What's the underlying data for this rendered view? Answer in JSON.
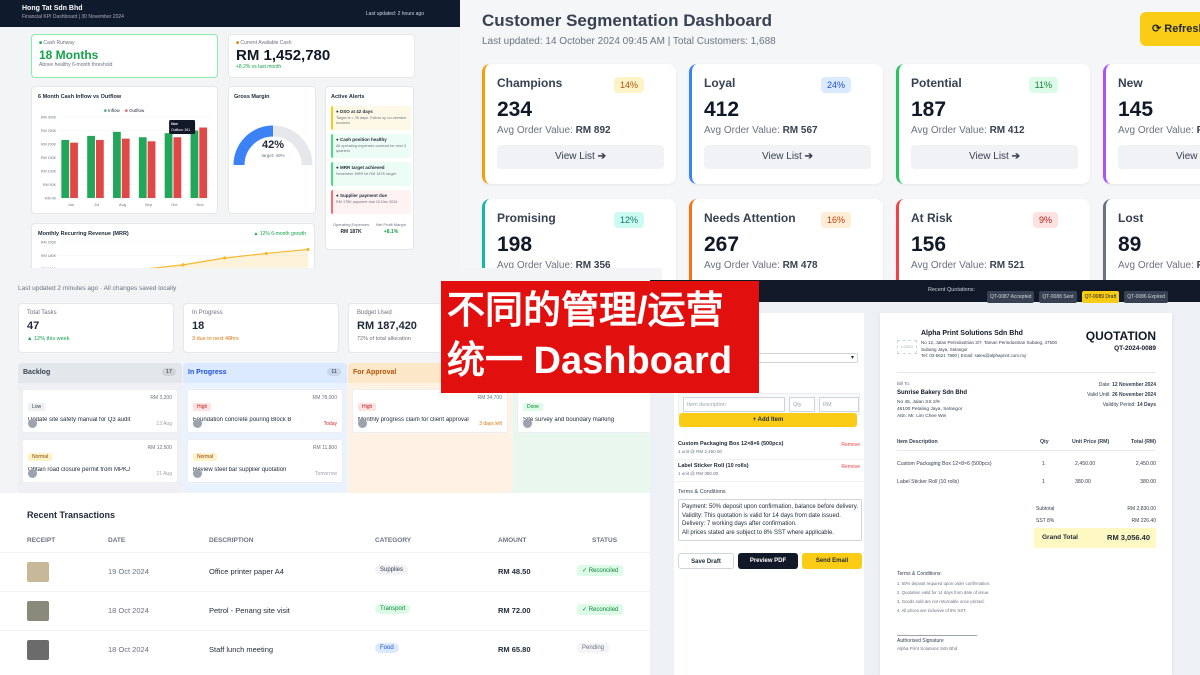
{
  "kpi": {
    "company": "Hong Tat Sdn Bhd",
    "subtitle": "Financial KPI Dashboard | 30 November 2024",
    "updated": "Last updated: 2 hours ago",
    "runway_label": "Cash Runway",
    "runway_value": "18 Months",
    "runway_note": "Above healthy 6-month threshold",
    "cash_label": "Current Available Cash",
    "cash_value": "RM 1,452,780",
    "cash_note": "+8.2% vs last month",
    "chart_title": "6 Month Cash Inflow vs Outflow",
    "legend_in": "Inflow",
    "legend_out": "Outflow",
    "tooltip_title": "Nov",
    "tooltip_value": "Outflow: 261",
    "margin_title": "Gross Margin",
    "margin_value": "42%",
    "margin_target": "target: 40%",
    "alerts_title": "Active Alerts",
    "alerts": [
      {
        "t": "DSO at 42 days",
        "d": "Target is < 35 days. Follow up on overdue invoices",
        "bg": "#fef9e7",
        "bd": "#facc15"
      },
      {
        "t": "Cash position healthy",
        "d": "All operating expenses covered for next 3 quarters",
        "bg": "#ecfdf5",
        "bd": "#4ade80"
      },
      {
        "t": "MRR target achieved",
        "d": "November MRR hit RM 187K target",
        "bg": "#ecfdf5",
        "bd": "#4ade80"
      },
      {
        "t": "Supplier payment due",
        "d": "RM 175K payment due 10 Dec 2024",
        "bg": "#fef2f2",
        "bd": "#f87171"
      }
    ],
    "mrr_title": "Monthly Recurring Revenue (MRR)",
    "mrr_growth": "▲ 12% 6-month growth",
    "opex_label": "Operating Expenses",
    "opex_value": "RM 187K",
    "net_label": "Net Profit Margin",
    "net_value": "+8.1%"
  },
  "chart_data": {
    "type": "bar",
    "title": "6 Month Cash Inflow vs Outflow",
    "categories": [
      "Jun",
      "Jul",
      "Aug",
      "Sep",
      "Oct",
      "Nov"
    ],
    "ylim": [
      0,
      300
    ],
    "y_ticks": [
      "RM 300K",
      "RM 250K",
      "RM 200K",
      "RM 150K",
      "RM 100K",
      "RM 50K",
      "RM 0K"
    ],
    "series": [
      {
        "name": "Inflow",
        "values": [
          215,
          230,
          245,
          225,
          240,
          250
        ],
        "color": "#22a65a"
      },
      {
        "name": "Outflow",
        "values": [
          205,
          215,
          220,
          210,
          225,
          261
        ],
        "color": "#e04848"
      }
    ]
  },
  "mrr_chart": {
    "type": "line",
    "y_ticks": [
      "RM 200K",
      "RM 180K",
      "RM 160K",
      "RM 140K"
    ],
    "values": [
      135,
      140,
      152,
      160,
      172,
      180,
      187
    ],
    "ylim": [
      130,
      200
    ]
  },
  "seg": {
    "title": "Customer Segmentation Dashboard",
    "subtitle": "Last updated: 14 October 2024 09:45 AM | Total Customers: 1,688",
    "refresh": "Refresh",
    "aov_label": "Avg Order Value:",
    "view": "View List",
    "cards": [
      {
        "name": "Champions",
        "pct": "14%",
        "count": "234",
        "aov": "RM 892",
        "color": "#f59e0b",
        "pbg": "#fef3c7",
        "pfg": "#b45309"
      },
      {
        "name": "Loyal",
        "pct": "24%",
        "count": "412",
        "aov": "RM 567",
        "color": "#3b82f6",
        "pbg": "#dbeafe",
        "pfg": "#1d4ed8"
      },
      {
        "name": "Potential",
        "pct": "11%",
        "count": "187",
        "aov": "RM 412",
        "color": "#22c55e",
        "pbg": "#dcfce7",
        "pfg": "#15803d"
      },
      {
        "name": "New",
        "pct": "",
        "count": "145",
        "aov": "RM 2",
        "color": "#a855f7",
        "pbg": "#f3e8ff",
        "pfg": "#7e22ce"
      },
      {
        "name": "Promising",
        "pct": "12%",
        "count": "198",
        "aov": "RM 356",
        "color": "#14b8a6",
        "pbg": "#ccfbf1",
        "pfg": "#0f766e"
      },
      {
        "name": "Needs Attention",
        "pct": "16%",
        "count": "267",
        "aov": "RM 478",
        "color": "#f97316",
        "pbg": "#ffedd5",
        "pfg": "#c2410c"
      },
      {
        "name": "At Risk",
        "pct": "9%",
        "count": "156",
        "aov": "RM 521",
        "color": "#ef4444",
        "pbg": "#fee2e2",
        "pfg": "#b91c1c"
      },
      {
        "name": "Lost",
        "pct": "",
        "count": "89",
        "aov": "RM 1",
        "color": "#6b7280",
        "pbg": "#f3f4f6",
        "pfg": "#374151"
      }
    ]
  },
  "tasks": {
    "updated": "Last updated 2 minutes ago · All changes saved locally",
    "stats": [
      {
        "label": "Total Tasks",
        "value": "47",
        "note": "▲ 12% this week",
        "nc": "#16a34a"
      },
      {
        "label": "In Progress",
        "value": "18",
        "note": "3 due in next 48hrs",
        "nc": "#d97706"
      },
      {
        "label": "Budget Used",
        "value": "RM 187,420",
        "note": "72% of total allocation",
        "nc": "#6b7280"
      }
    ],
    "columns": [
      {
        "name": "Backlog",
        "count": "17",
        "bg": "#eef0f3",
        "hd": "#e3e6ea",
        "fg": "#374151",
        "tasks": [
          {
            "tag": "Low",
            "amt": "RM 3,200",
            "title": "Update site safety manual for Q3 audit",
            "due": "13 Aug",
            "tbg": "#eef0f3",
            "tfg": "#374151",
            "dc": "#9ca3af"
          },
          {
            "tag": "Normal",
            "amt": "RM 12,500",
            "title": "Obtain road closure permit from MPKJ",
            "due": "21 Aug",
            "tbg": "#fef3c7",
            "tfg": "#92400e",
            "dc": "#9ca3af"
          }
        ]
      },
      {
        "name": "In Progress",
        "count": "11",
        "bg": "#eaf2fe",
        "hd": "#dbeafe",
        "fg": "#1d4ed8",
        "tasks": [
          {
            "tag": "High",
            "amt": "RM 78,000",
            "title": "Foundation concrete pouring Block B",
            "due": "Today",
            "tbg": "#fee2e2",
            "tfg": "#b91c1c",
            "dc": "#dc2626"
          },
          {
            "tag": "Normal",
            "amt": "RM 11,800",
            "title": "Review steel bar supplier quotation",
            "due": "Tomorrow",
            "tbg": "#fef3c7",
            "tfg": "#92400e",
            "dc": "#9ca3af"
          }
        ]
      },
      {
        "name": "For Approval",
        "count": "",
        "bg": "#fdf2e4",
        "hd": "#fde7c9",
        "fg": "#b45309",
        "tasks": [
          {
            "tag": "High",
            "amt": "RM 34,700",
            "title": "Monthly progress claim for client approval",
            "due": "3 days left",
            "tbg": "#fee2e2",
            "tfg": "#b91c1c",
            "dc": "#d97706"
          }
        ]
      },
      {
        "name": "",
        "count": "",
        "bg": "#eaf7ee",
        "hd": "#eaf7ee",
        "fg": "#15803d",
        "tasks": [
          {
            "tag": "Done",
            "amt": "",
            "title": "Site survey and boundary marking",
            "due": "✓ 2",
            "tbg": "#dcfce7",
            "tfg": "#15803d",
            "dc": "#16a34a"
          }
        ]
      }
    ]
  },
  "txn": {
    "title": "Recent Transactions",
    "headers": [
      "RECEIPT",
      "DATE",
      "DESCRIPTION",
      "CATEGORY",
      "AMOUNT",
      "STATUS"
    ],
    "rows": [
      {
        "date": "19 Oct 2024",
        "desc": "Office printer paper A4",
        "cat": "Supplies",
        "amt": "RM 48.50",
        "status": "✓ Reconciled",
        "cbg": "#f1f2f4",
        "cfg": "#374151",
        "sbg": "#dcfce7",
        "sfg": "#15803d",
        "thumb": "#c8b89a"
      },
      {
        "date": "18 Oct 2024",
        "desc": "Petrol - Penang site visit",
        "cat": "Transport",
        "amt": "RM 72.00",
        "status": "✓ Reconciled",
        "cbg": "#dcfce7",
        "cfg": "#15803d",
        "sbg": "#dcfce7",
        "sfg": "#15803d",
        "thumb": "#8a8a7a"
      },
      {
        "date": "18 Oct 2024",
        "desc": "Staff lunch meeting",
        "cat": "Food",
        "amt": "RM 65.80",
        "status": "Pending",
        "cbg": "#dbeafe",
        "cfg": "#1d4ed8",
        "sbg": "#f3f4f6",
        "sfg": "#6b7280",
        "thumb": "#6b6b6b"
      }
    ]
  },
  "quote": {
    "recent_label": "Recent Quotations:",
    "chips": [
      {
        "t": "QT-0087 Accepted",
        "bg": "#374151",
        "fg": "#d1d5db"
      },
      {
        "t": "QT-0088 Sent",
        "bg": "#374151",
        "fg": "#d1d5db"
      },
      {
        "t": "QT-0089 Draft",
        "bg": "#facc15",
        "fg": "#111827"
      },
      {
        "t": "QT-0086 Expired",
        "bg": "#374151",
        "fg": "#d1d5db"
      }
    ],
    "item_placeholder": "Item description",
    "qty_placeholder": "Qty",
    "price_placeholder": "RM",
    "add_item": "+ Add Item",
    "items_form": [
      {
        "name": "Custom Packaging Box 12×8×6 (500pcs)",
        "sub": "1 unit @ RM 2,450.00"
      },
      {
        "name": "Label Sticker Roll (10 rolls)",
        "sub": "1 unit @ RM 380.00"
      }
    ],
    "remove": "Remove",
    "terms_title": "Terms & Conditions",
    "terms_text": "Payment: 50% deposit upon confirmation, balance before delivery.\nValidity: This quotation is valid for 14 days from date issued.\nDelivery: 7 working days after confirmation.\nAll prices stated are subject to 8% SST where applicable.",
    "save_draft": "Save Draft",
    "preview_pdf": "Preview PDF",
    "send_email": "Send Email",
    "logo": "LOGO",
    "company": "Alpha Print Solutions Sdn Bhd",
    "addr1": "No 12, Jalan Perindustrian 3/7, Taman Perindustrian Subang, 47500",
    "addr2": "Subang Jaya, Selangor",
    "addr3": "Tel: 03-5621 7890 | Email: sales@alphaprint.com.my",
    "doc_title": "QUOTATION",
    "doc_no": "QT-2024-0089",
    "bill_to": "Bill To:",
    "client": "Sunrise Bakery Sdn Bhd",
    "c1": "No 45, Jalan SS 2/9",
    "c2": "46100 Petaling Jaya, Selangor",
    "c3": "Attn: Mr. Lim Chee Wei",
    "date_label": "Date:",
    "date_value": "12 November 2024",
    "valid_label": "Valid Until:",
    "valid_value": "26 November 2024",
    "period_label": "Validity Period:",
    "period_value": "14 Days",
    "cols": [
      "Item Description",
      "Qty",
      "Unit Price (RM)",
      "Total (RM)"
    ],
    "items": [
      {
        "d": "Custom Packaging Box 12×8×6 (500pcs)",
        "q": "1",
        "u": "2,450.00",
        "t": "2,450.00"
      },
      {
        "d": "Label Sticker Roll (10 rolls)",
        "q": "1",
        "u": "380.00",
        "t": "380.00"
      }
    ],
    "subtotal_label": "Subtotal",
    "subtotal": "RM 2,830.00",
    "sst_label": "SST 8%",
    "sst": "RM 226.40",
    "grand_label": "Grand Total",
    "grand": "RM 3,056.40",
    "tc_title": "Terms & Conditions:",
    "tc": [
      "1. 50% deposit required upon order confirmation.",
      "2. Quotation valid for 14 days from date of issue.",
      "3. Goods sold are not returnable once printed.",
      "4. All prices are inclusive of 8% SST."
    ],
    "sig": "Authorised Signature",
    "sig_co": "Alpha Print Solutions Sdn Bhd"
  },
  "overlay": {
    "line1": "不同的管理/运营",
    "line2": "统一 Dashboard"
  }
}
